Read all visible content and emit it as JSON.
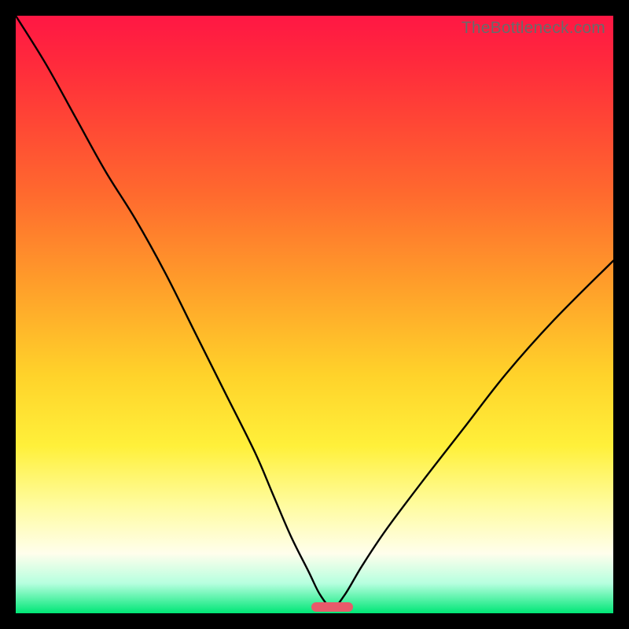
{
  "watermark": "TheBottleneck.com",
  "colors": {
    "gradient_top": "#ff1744",
    "gradient_bottom": "#00e676",
    "curve": "#000000",
    "marker": "#e85a6a",
    "frame": "#000000"
  },
  "chart_data": {
    "type": "line",
    "title": "",
    "xlabel": "",
    "ylabel": "",
    "xlim": [
      0,
      100
    ],
    "ylim": [
      0,
      100
    ],
    "notes": "No axis ticks or labels are shown; values are estimated from relative pixel position. y=0 is bottom (green), y=100 is top (red). The curve depicts a V-shaped bottleneck with its minimum near x≈53.",
    "series": [
      {
        "name": "bottleneck-curve",
        "x": [
          0,
          5,
          10,
          15,
          20,
          25,
          30,
          35,
          40,
          43,
          46,
          49,
          51,
          53,
          55,
          58,
          62,
          68,
          75,
          82,
          90,
          100
        ],
        "y": [
          100,
          92,
          83,
          74,
          66,
          57,
          47,
          37,
          27,
          20,
          13,
          7,
          3,
          1,
          3,
          8,
          14,
          22,
          31,
          40,
          49,
          59
        ]
      }
    ],
    "marker": {
      "name": "optimal-zone",
      "x_center": 53,
      "width_pct_of_x": 7,
      "y": 1
    }
  }
}
